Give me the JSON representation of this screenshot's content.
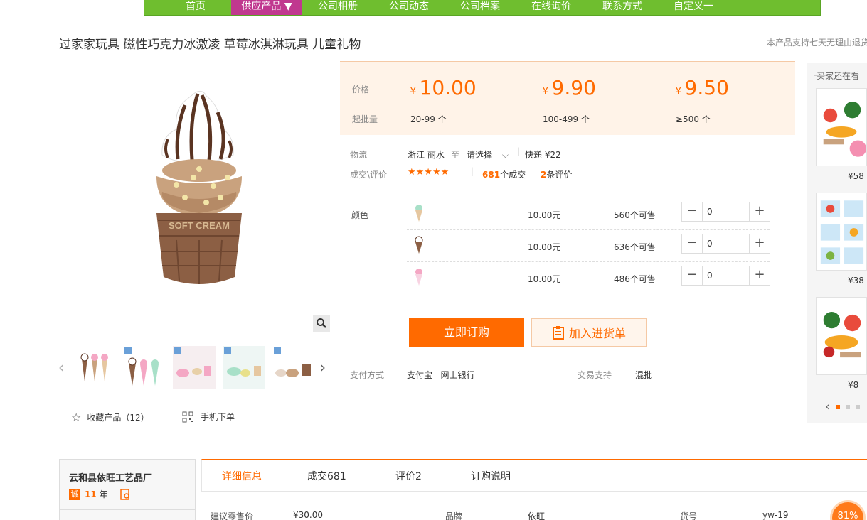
{
  "nav": [
    "首页",
    "供应产品 ▼",
    "公司相册",
    "公司动态",
    "公司档案",
    "在线询价",
    "联系方式",
    "自定义一"
  ],
  "product": {
    "title": "过家家玩具 磁性巧克力冰激凌 草莓冰淇淋玩具 儿童礼物",
    "return_note": "本产品支持七天无理由退货"
  },
  "gallery": {
    "brand_text": "SOFT CREAM",
    "favorite_label": "收藏产品（12）",
    "mobile_label": "手机下单"
  },
  "price": {
    "price_label": "价格",
    "qty_label": "起批量",
    "currency": "¥",
    "tiers": [
      {
        "price": "10.00",
        "qty": "20-99 个"
      },
      {
        "price": "9.90",
        "qty": "100-499 个"
      },
      {
        "price": "9.50",
        "qty": "≥500 个"
      }
    ]
  },
  "logistics": {
    "label": "物流",
    "from": "浙江 丽水",
    "to_word": "至",
    "select": "请选择",
    "express": "快递 ¥22"
  },
  "rating": {
    "label": "成交\\评价",
    "stars": "★★★★★",
    "deals_num": "681",
    "deals_text": "个成交",
    "reviews_num": "2",
    "reviews_text": "条评价"
  },
  "sku": {
    "label": "颜色",
    "rows": [
      {
        "price": "10.00元",
        "stock": "560个可售",
        "qty": "0",
        "color": "#a8e0c8"
      },
      {
        "price": "10.00元",
        "stock": "636个可售",
        "qty": "0",
        "color": "#8b5a3c"
      },
      {
        "price": "10.00元",
        "stock": "486个可售",
        "qty": "0",
        "color": "#f4a7c4"
      }
    ]
  },
  "actions": {
    "buy": "立即订购",
    "cart": "加入进货单"
  },
  "payment": {
    "label": "支付方式",
    "methods": "支付宝   网上银行",
    "support_label": "交易支持",
    "support_value": "混批"
  },
  "reco": {
    "title": "买家还在看",
    "prices": [
      "¥58",
      "¥38",
      "¥8"
    ]
  },
  "shop": {
    "name": "云和县依旺工艺品厂",
    "badge": "诚",
    "years": "11",
    "years_unit": "年"
  },
  "tabs": [
    "详细信息",
    "成交681",
    "评价2",
    "订购说明"
  ],
  "attrs": [
    {
      "k": "建议零售价",
      "v": "¥30.00"
    },
    {
      "k": "品牌",
      "v": "依旺"
    },
    {
      "k": "货号",
      "v": "yw-19"
    }
  ],
  "score": "81%"
}
